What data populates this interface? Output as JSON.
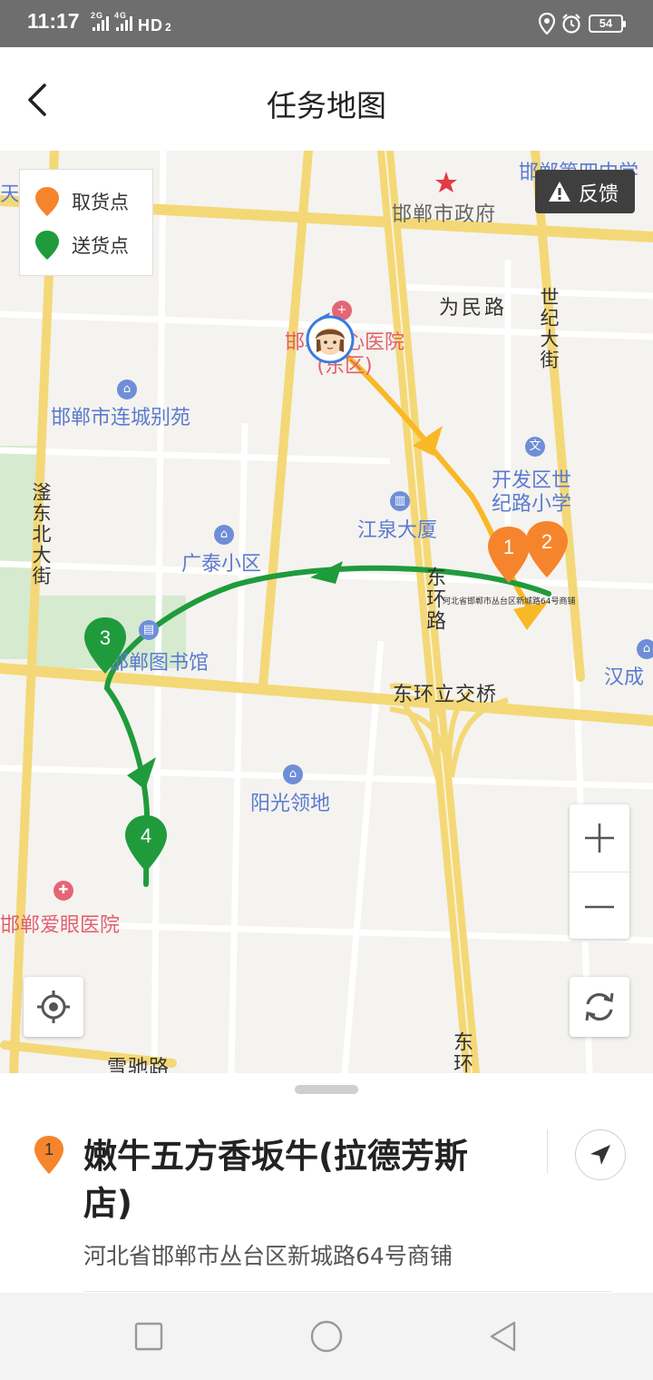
{
  "status_bar": {
    "time": "11:17",
    "network": "2G 4G HD2",
    "battery": "54"
  },
  "header": {
    "title": "任务地图"
  },
  "legend": {
    "pickup_label": "取货点",
    "delivery_label": "送货点",
    "pickup_color": "#f6842c",
    "delivery_color": "#1f9b3c"
  },
  "feedback": {
    "label": "反馈"
  },
  "map_labels": {
    "school_4": "邯郸第四中学",
    "city_gov": "邯郸市政府",
    "weimin_road": "为民路",
    "century_ave": "世纪大街",
    "hospital": "邯郸中心医院(东区)",
    "liancheng": "邯郸市连城别苑",
    "fuyang_north": "滏东北大街",
    "kaifa_school_1": "开发区世",
    "kaifa_school_2": "纪路小学",
    "jiangquan": "江泉大厦",
    "guangtai": "广泰小区",
    "dong_huan": "东环路",
    "library": "邯郸图书馆",
    "dh_bridge": "东环立交桥",
    "hancheng": "汉成",
    "yangguang": "阳光领地",
    "aiyan": "邯郸爱眼医院",
    "xuechi_road": "雪驰路",
    "dong_huan_2": "东环",
    "tiny_address": "河北省邯郸市丛台区新城路64号商铺",
    "tianhe": "天河"
  },
  "markers": [
    {
      "num": "1",
      "type": "pickup"
    },
    {
      "num": "2",
      "type": "pickup"
    },
    {
      "num": "3",
      "type": "delivery"
    },
    {
      "num": "4",
      "type": "delivery"
    }
  ],
  "sheet": {
    "index": "1",
    "store_name": "嫩牛五方香坂牛(拉德芳斯店)",
    "address": "河北省邯郸市丛台区新城路64号商铺"
  }
}
